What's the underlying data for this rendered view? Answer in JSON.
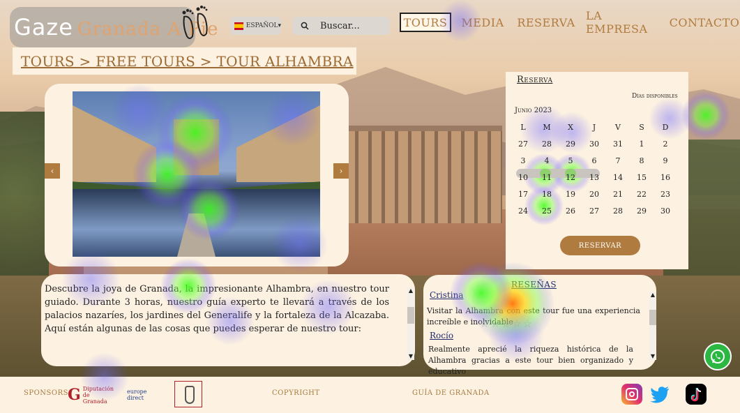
{
  "header": {
    "logo_main": "Gaze",
    "logo_sub": "Granada A Pie",
    "language": "ESPAÑOL▾",
    "search_placeholder": "Buscar...",
    "nav": [
      "TOURS",
      "MEDIA",
      "RESERVA",
      "LA EMPRESA",
      "CONTACTO"
    ],
    "active_nav": "TOURS"
  },
  "breadcrumb": "TOURS > FREE TOURS > TOUR ALHAMBRA",
  "carousel": {
    "prev": "‹",
    "next": "›"
  },
  "description": "Descubre la joya de Granada, la impresionante Alhambra, en nuestro tour guiado. Durante 3 horas, nuestro guía experto te llevará a través de los palacios nazaríes, los jardines del Generalife y la fortaleza de la Alcazaba. Aquí están algunas de las cosas que puedes esperar de nuestro tour:",
  "reviews": {
    "title": "RESEÑAS",
    "items": [
      {
        "name": "Cristina",
        "text": "Visitar la Alhambra con este tour fue una experiencia increíble e inolvidable",
        "stars": "☆☆☆☆☆"
      },
      {
        "name": "Rocío",
        "text": "Realmente aprecié la riqueza histórica de la Alhambra gracias a este tour bien organizado y educativo"
      }
    ]
  },
  "reserva": {
    "title": "Reserva",
    "available_label": "Días disponibles",
    "month": "Junio 2023",
    "weekdays": [
      "L",
      "M",
      "X",
      "J",
      "V",
      "S",
      "D"
    ],
    "weeks": [
      [
        "27",
        "28",
        "29",
        "30",
        "31",
        "1",
        "2"
      ],
      [
        "3",
        "4",
        "5",
        "6",
        "7",
        "8",
        "9"
      ],
      [
        "10",
        "11",
        "12",
        "13",
        "14",
        "15",
        "16"
      ],
      [
        "17",
        "18",
        "19",
        "20",
        "21",
        "22",
        "23"
      ],
      [
        "24",
        "25",
        "26",
        "27",
        "28",
        "29",
        "30"
      ]
    ],
    "button": "RESERVAR"
  },
  "footer": {
    "sponsors": "SPONSORS",
    "sponsor1": "Diputación de Granada",
    "sponsor2": "europe direct",
    "copyright": "COPYRIGHT",
    "guide": "GUÍA DE GRANADA"
  },
  "colors": {
    "accent": "#b07b3e",
    "panel": "#fdf2e1",
    "review_link": "#1f2a6b",
    "whatsapp": "#2bb741"
  },
  "icons": [
    "feet-icon",
    "search-icon",
    "spain-flag-icon",
    "instagram-icon",
    "twitter-icon",
    "tiktok-icon",
    "whatsapp-icon"
  ]
}
